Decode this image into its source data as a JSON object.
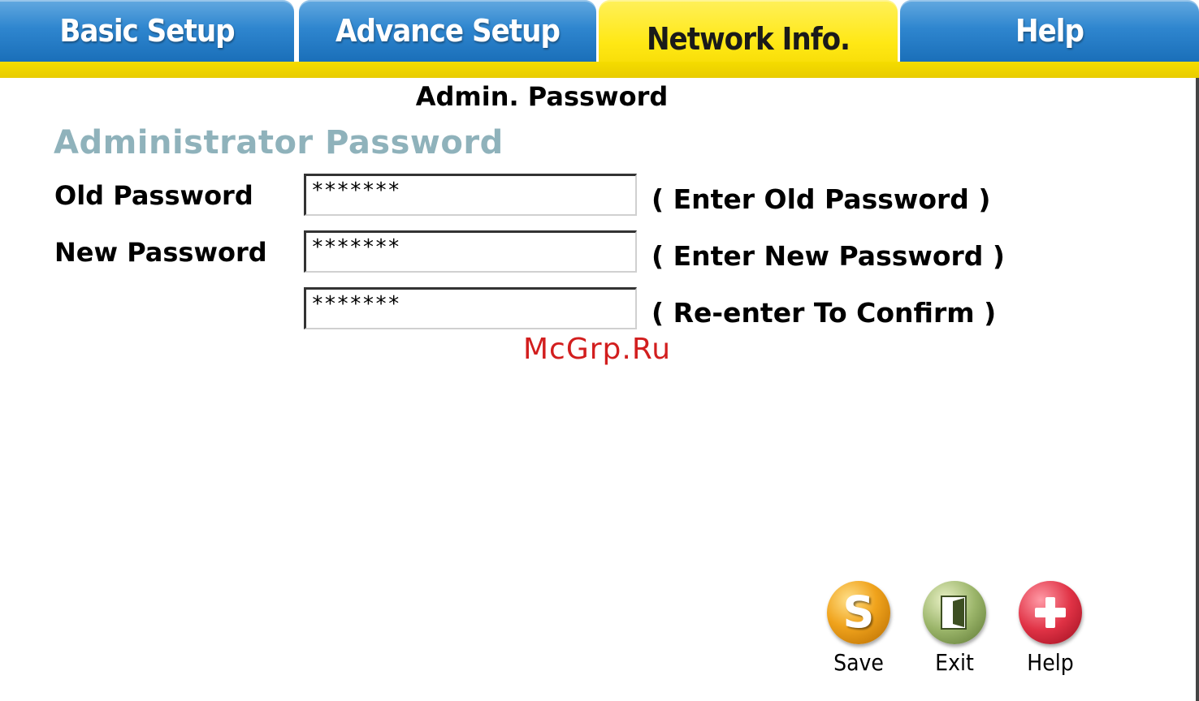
{
  "tabs": {
    "basic_setup": "Basic Setup",
    "advance_setup": "Advance Setup",
    "network_info": "Network Info.",
    "help": "Help",
    "active": "network_info"
  },
  "page": {
    "title": "Admin. Password",
    "section_title": "Administrator Password"
  },
  "form": {
    "old_password_label": "Old Password",
    "old_password_value": "*******",
    "old_password_hint": "( Enter Old Password )",
    "new_password_label": "New Password",
    "new_password_value": "*******",
    "new_password_hint": "( Enter New Password )",
    "confirm_password_value": "*******",
    "confirm_password_hint": "( Re-enter To Confirm )"
  },
  "watermark": "McGrp.Ru",
  "buttons": {
    "save_label": "Save",
    "save_icon": "save-icon",
    "exit_label": "Exit",
    "exit_icon": "exit-door-icon",
    "help_label": "Help",
    "help_icon": "plus-icon"
  },
  "colors": {
    "tab_blue": "#2f86cf",
    "tab_active_yellow": "#ffe815",
    "section_title": "#8fb2bb",
    "watermark_red": "#d21e1e"
  }
}
